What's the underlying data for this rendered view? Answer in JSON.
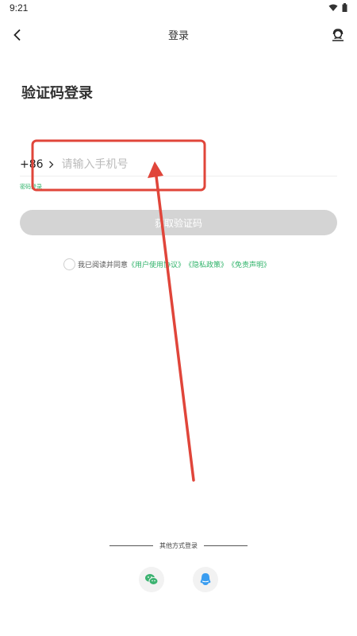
{
  "status_bar": {
    "time": "9:21"
  },
  "nav": {
    "title": "登录"
  },
  "page": {
    "title": "验证码登录"
  },
  "phone": {
    "country_code": "+86",
    "placeholder": "请输入手机号"
  },
  "links": {
    "password_login": "密码登录"
  },
  "buttons": {
    "get_code": "获取验证码"
  },
  "agreement": {
    "prefix": "我已阅读并同意",
    "user_agreement": "《用户使用协议》",
    "privacy_policy": "《隐私政策》",
    "disclaimer": "《免责声明》"
  },
  "other_login": {
    "label": "其他方式登录"
  },
  "colors": {
    "accent_green": "#2fb36a",
    "button_disabled": "#d4d4d4",
    "annotation_red": "#e0453a",
    "wechat_green": "#3cb371",
    "qq_blue": "#3a9df0"
  },
  "icons": {
    "back": "chevron-left-icon",
    "service": "customer-service-icon",
    "chevron": "chevron-right-icon",
    "wechat": "wechat-icon",
    "qq": "qq-icon"
  }
}
